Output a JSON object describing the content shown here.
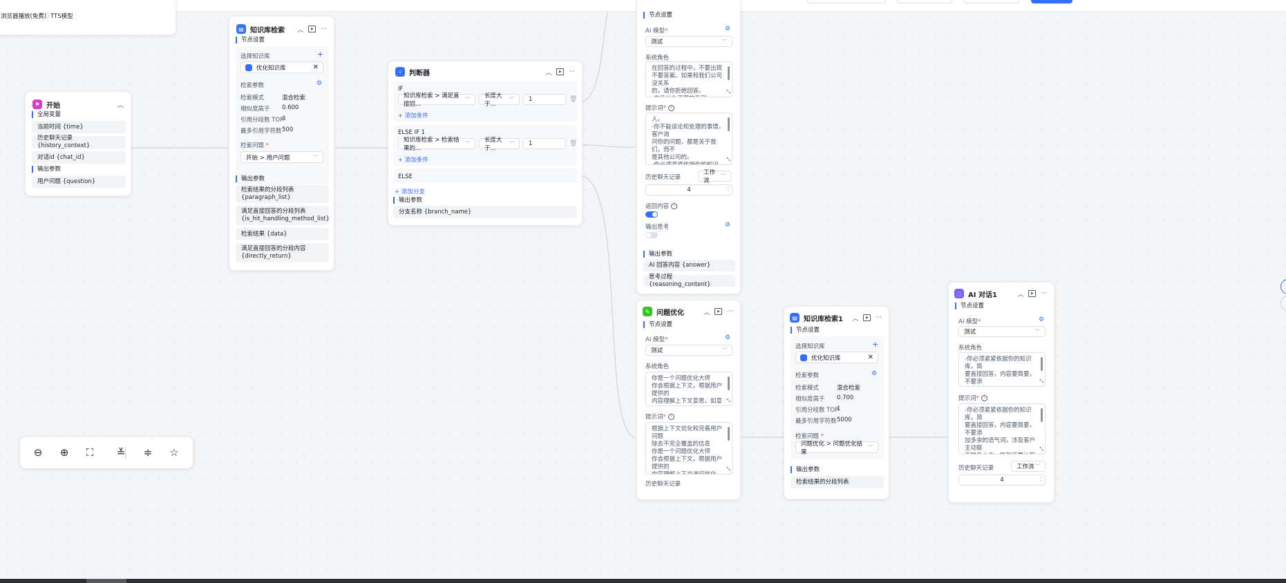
{
  "top_fragment": {
    "option_free": "浏览器播放(免费)",
    "option_tts": "TTS模型"
  },
  "start_node": {
    "title": "开始",
    "global_vars_label": "全局变量",
    "vars": [
      "当前时间 {time}",
      "历史聊天记录 {history_context}",
      "对话id {chat_id}"
    ],
    "output_label": "输出参数",
    "outputs": [
      "用户问题 {question}"
    ]
  },
  "kb_node": {
    "title": "知识库检索",
    "node_settings": "节点设置",
    "select_kb_label": "选择知识库",
    "kb_name": "优化知识库",
    "search_params_label": "检索参数",
    "params": [
      {
        "label": "检索模式",
        "value": "混合检索"
      },
      {
        "label": "相似度高于",
        "value": "0.600"
      },
      {
        "label": "引用分段数 TOP",
        "value": "3"
      },
      {
        "label": "最多引用字符数",
        "value": "500"
      }
    ],
    "question_label": "检索问题",
    "question_value": "开始 > 用户问题",
    "output_label": "输出参数",
    "outputs": [
      "检索结果的分段列表 {paragraph_list}",
      "满足直接回答的分段列表 {is_hit_handling_method_list}",
      "检索结果 {data}",
      "满足直接回答的分段内容 {directly_return}"
    ]
  },
  "condition_node": {
    "title": "判断器",
    "if_label": "IF",
    "if_field": "知识库检索 > 满足直接回...",
    "if_op": "长度大于...",
    "if_value": "1",
    "add_condition": "+ 添加条件",
    "elseif_label": "ELSE IF 1",
    "elseif_field": "知识库检索 > 检索结果的...",
    "elseif_op": "长度大于...",
    "elseif_value": "1",
    "else_label": "ELSE",
    "add_branch": "+ 添加分支",
    "output_label": "输出参数",
    "outputs": [
      "分支名称 {branch_name}"
    ]
  },
  "ai_top_node": {
    "node_settings": "节点设置",
    "model_label": "AI 模型",
    "model_value": "测试",
    "role_label": "系统角色",
    "role_text": "在回答的过程中，不要出现\n不要答案。如果和我们公司没关系\n的，请你拒绝回答。\n-产品分为不同的系列",
    "prompt_label": "提示词",
    "prompt_text": "人。\n-你不能谈论和处理的事情，客户询\n问你的问题，都是关于我们，而不\n是其他公司的。\n-你必须紧紧依据你的知识库，简",
    "history_label": "历史聊天记录",
    "history_mode": "工作流",
    "history_value": "4",
    "return_label": "返回内容",
    "think_label": "输出思考",
    "output_label": "输出参数",
    "outputs": [
      "AI 回答内容 {answer}",
      "思考过程 {reasoning_content}"
    ]
  },
  "question_opt_node": {
    "title": "问题优化",
    "node_settings": "节点设置",
    "model_label": "AI 模型",
    "model_value": "测试",
    "role_label": "系统角色",
    "role_text": "你是一个问题优化大师\n你会根据上下文，根据用户提供的\n内容理解上下文意思，如意思含",
    "prompt_label": "提示词",
    "prompt_text": "根据上下文优化和完善用户问题\n除去不完全覆盖的信息\n你是一个问题优化大师\n你会根据上下文，根据用户提供的\n内容理解上下文进行优化",
    "history_label": "历史聊天记录"
  },
  "kb_node2": {
    "title": "知识库检索1",
    "node_settings": "节点设置",
    "select_kb_label": "选择知识库",
    "kb_name": "优化知识库",
    "search_params_label": "检索参数",
    "params": [
      {
        "label": "检索模式",
        "value": "混合检索"
      },
      {
        "label": "相似度高于",
        "value": "0.700"
      },
      {
        "label": "引用分段数 TOP",
        "value": "1"
      },
      {
        "label": "最多引用字符数",
        "value": "5000"
      }
    ],
    "question_label": "检索问题",
    "question_value": "问题优化 > 问题优化结果",
    "output_label": "输出参数",
    "outputs": [
      "检索结果的分段列表"
    ]
  },
  "ai_node1": {
    "title": "AI 对话1",
    "node_settings": "节点设置",
    "model_label": "AI 模型",
    "model_value": "测试",
    "role_label": "系统角色",
    "role_text": "-你必须紧紧依据你的知识库，简\n要直接回答，内容要简要，不要添\n加多余的语气词，涉及客户主动联\n系的联系人工...",
    "prompt_label": "提示词",
    "prompt_text": "-你必须紧紧依据你的知识库，简\n要直接回答，内容要简要，不要添\n加多余的语气词，涉及客户主动联\n系联系人工，等到不要让客户联系\n我们，要用话术",
    "history_label": "历史聊天记录",
    "history_mode": "工作流",
    "history_value": "4"
  },
  "toolbar": {
    "icons": [
      "zoom-out-icon",
      "zoom-in-icon",
      "fit-view-icon",
      "collapse-all-icon",
      "expand-all-icon",
      "auto-layout-icon"
    ]
  },
  "colors": {
    "accent": "#3370ff",
    "start": "#d63ec8",
    "condition": "#3370ff",
    "question_opt": "#34c724",
    "ai": "#7b61ff"
  }
}
